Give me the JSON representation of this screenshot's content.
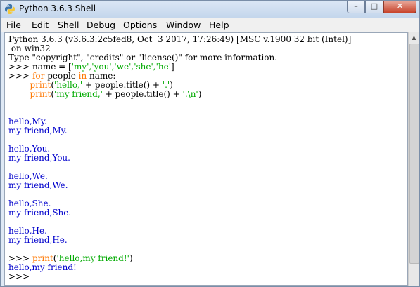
{
  "window": {
    "title": "Python 3.6.3 Shell",
    "controls": {
      "minimize": "–",
      "maximize": "□",
      "close": "✕"
    }
  },
  "menu": [
    "File",
    "Edit",
    "Shell",
    "Debug",
    "Options",
    "Window",
    "Help"
  ],
  "shell": {
    "banner_line1": "Python 3.6.3 (v3.6.3:2c5fed8, Oct  3 2017, 17:26:49) [MSC v.1900 32 bit (Intel)]",
    "banner_line2": " on win32",
    "banner_line3": "Type \"copyright\", \"credits\" or \"license()\" for more information.",
    "prompt": ">>> ",
    "line4_code": "name = [",
    "line4_str": "'my','you','we','she','he'",
    "line4_end": "]",
    "line5_kw1": "for",
    "line5_mid": " people ",
    "line5_kw2": "in",
    "line5_end": " name:",
    "line6_indent": "        ",
    "line6_kw": "print",
    "line6_open": "(",
    "line6_str": "'hello,'",
    "line6_rest": " + people.title() + ",
    "line6_str2": "'.'",
    "line6_close": ")",
    "line7_indent": "        ",
    "line7_kw": "print",
    "line7_open": "(",
    "line7_str": "'my friend,'",
    "line7_rest": " + people.title() + ",
    "line7_str2": "'.\\n'",
    "line7_close": ")",
    "output": [
      "hello,My.",
      "my friend,My.",
      "hello,You.",
      "my friend,You.",
      "hello,We.",
      "my friend,We.",
      "hello,She.",
      "my friend,She.",
      "hello,He.",
      "my friend,He."
    ],
    "last_kw": "print",
    "last_open": "(",
    "last_str": "'hello,my friend!'",
    "last_close": ")",
    "last_output": "hello,my friend!",
    "final_prompt": ">>> "
  }
}
